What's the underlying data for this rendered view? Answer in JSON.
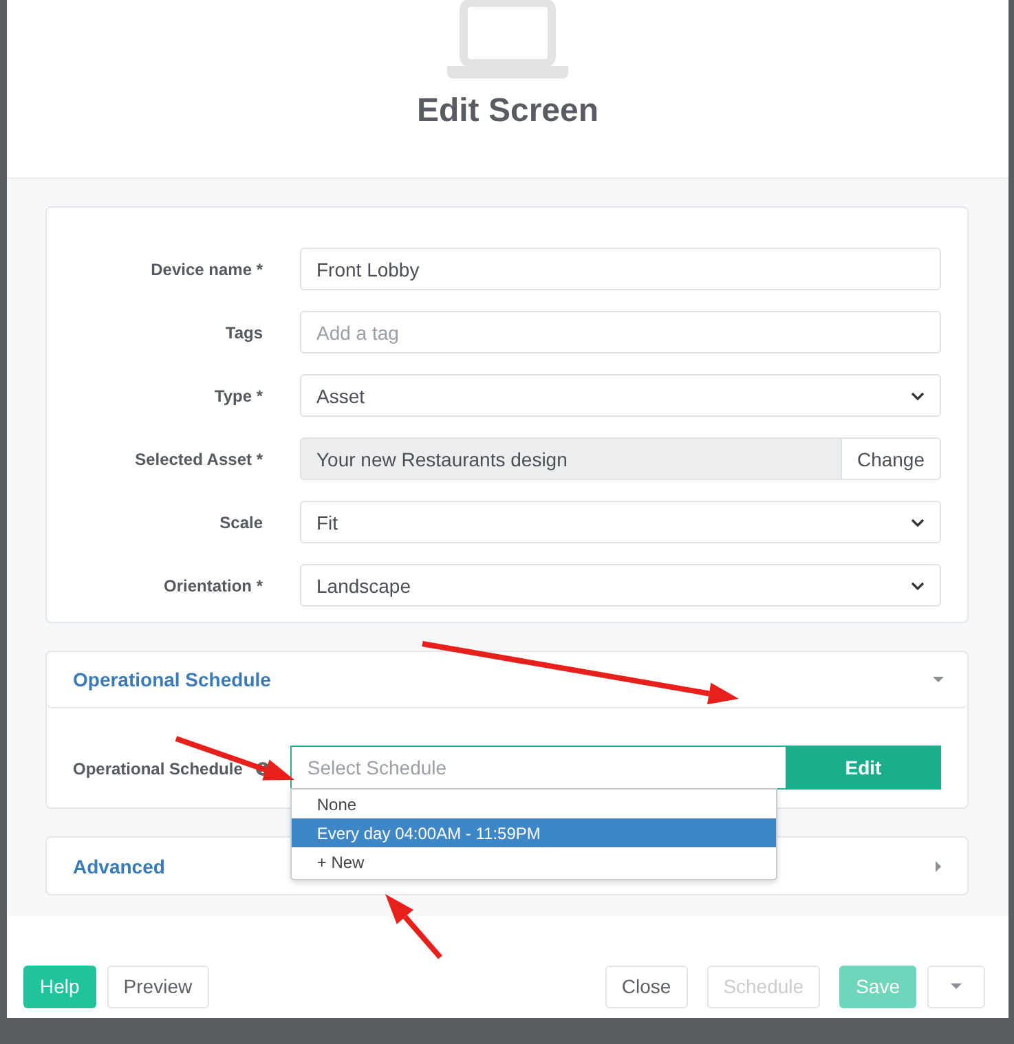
{
  "dialog": {
    "title": "Edit Screen"
  },
  "fields": [
    {
      "label": "Device name *",
      "kind": "text",
      "value": "Front Lobby"
    },
    {
      "label": "Tags",
      "kind": "text",
      "placeholder": "Add a tag"
    },
    {
      "label": "Type *",
      "kind": "select",
      "value": "Asset"
    },
    {
      "label": "Selected Asset *",
      "kind": "asset",
      "value": "Your new Restaurants design",
      "button": "Change"
    },
    {
      "label": "Scale",
      "kind": "select",
      "value": "Fit"
    },
    {
      "label": "Orientation *",
      "kind": "select",
      "value": "Landscape"
    }
  ],
  "sections": [
    {
      "title": "Operational Schedule",
      "expanded": true,
      "field": {
        "label": "Operational Schedule",
        "placeholder": "Select Schedule",
        "button": "Edit",
        "options": [
          {
            "label": "None",
            "selected": false
          },
          {
            "label": "Every day 04:00AM - 11:59PM",
            "selected": true
          },
          {
            "label": "+ New",
            "selected": false
          }
        ]
      }
    },
    {
      "title": "Advanced",
      "expanded": false
    }
  ],
  "footer": {
    "left": [
      {
        "label": "Help",
        "kind": "primary",
        "disabled": false
      },
      {
        "label": "Preview",
        "kind": "default",
        "disabled": false
      }
    ],
    "right": [
      {
        "label": "Close",
        "kind": "default",
        "disabled": false
      },
      {
        "label": "Schedule",
        "kind": "default",
        "disabled": true
      },
      {
        "label": "Save",
        "kind": "primary",
        "disabled": true
      }
    ]
  }
}
